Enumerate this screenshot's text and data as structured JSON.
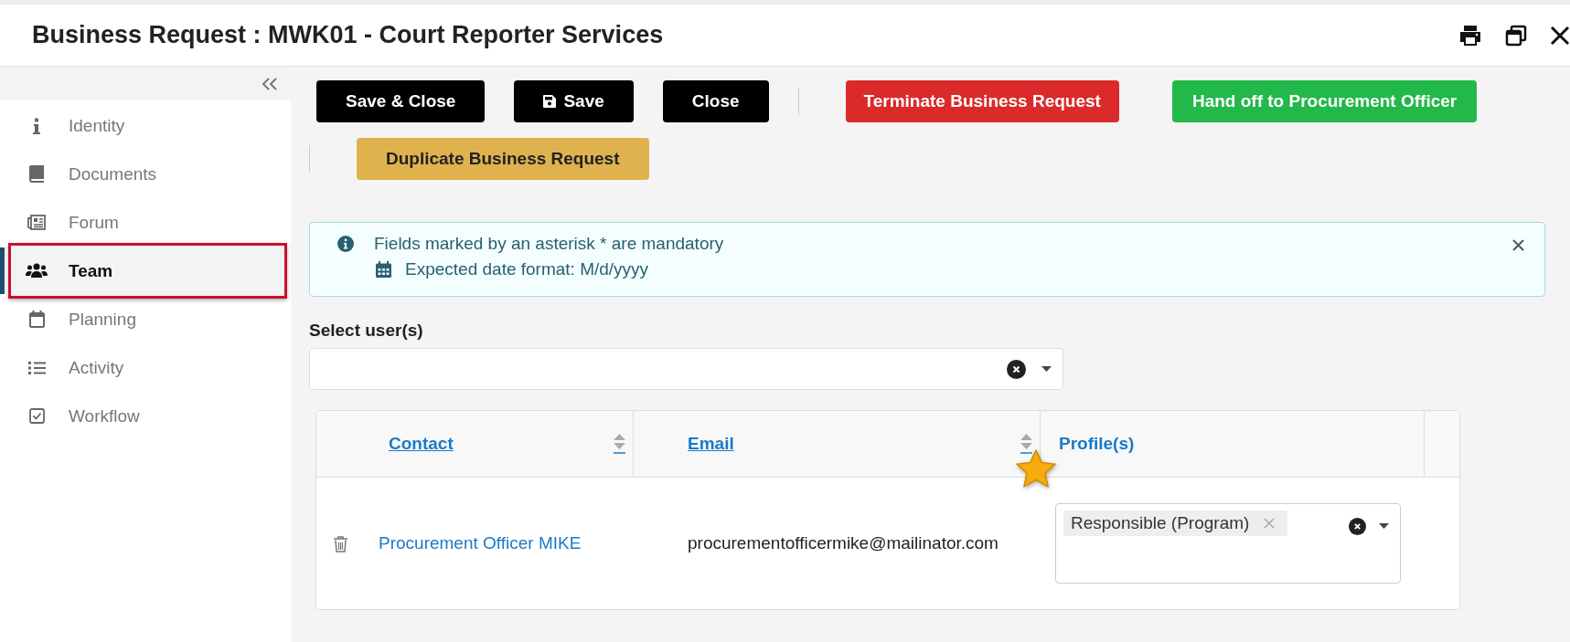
{
  "window": {
    "title": "Business Request : MWK01 - Court Reporter Services"
  },
  "sidebar": {
    "items": [
      {
        "label": "Identity",
        "kind": "info",
        "selected": false
      },
      {
        "label": "Documents",
        "kind": "book",
        "selected": false
      },
      {
        "label": "Forum",
        "kind": "news",
        "selected": false
      },
      {
        "label": "Team",
        "kind": "users",
        "selected": true
      },
      {
        "label": "Planning",
        "kind": "calendar",
        "selected": false
      },
      {
        "label": "Activity",
        "kind": "list",
        "selected": false
      },
      {
        "label": "Workflow",
        "kind": "check",
        "selected": false
      }
    ]
  },
  "toolbar": {
    "rows": [
      [
        {
          "label": "Save & Close",
          "kind": "dark"
        },
        {
          "label": "Save",
          "kind": "save"
        },
        {
          "label": "Close",
          "kind": "dark"
        },
        {
          "label": "Terminate Business Request",
          "kind": "danger"
        },
        {
          "label": "Hand off to Procurement Officer",
          "kind": "success"
        }
      ],
      [
        {
          "label": "Duplicate Business Request",
          "kind": "warning"
        }
      ]
    ]
  },
  "notice": {
    "lines": [
      {
        "text": "Fields marked by an asterisk * are mandatory",
        "kind": "info"
      },
      {
        "text": "Expected date format: M/d/yyyy",
        "kind": "calendar"
      }
    ]
  },
  "user_select": {
    "label": "Select user(s)"
  },
  "table": {
    "columns": [
      {
        "label": "Contact",
        "sortable": true
      },
      {
        "label": "Email",
        "sortable": true
      },
      {
        "label": "Profile(s)",
        "sortable": false
      }
    ],
    "rows": [
      {
        "contact": "Procurement Officer MIKE",
        "email": "procurementofficermike@mailinator.com",
        "profiles": [
          "Responsible (Program)"
        ]
      }
    ]
  }
}
